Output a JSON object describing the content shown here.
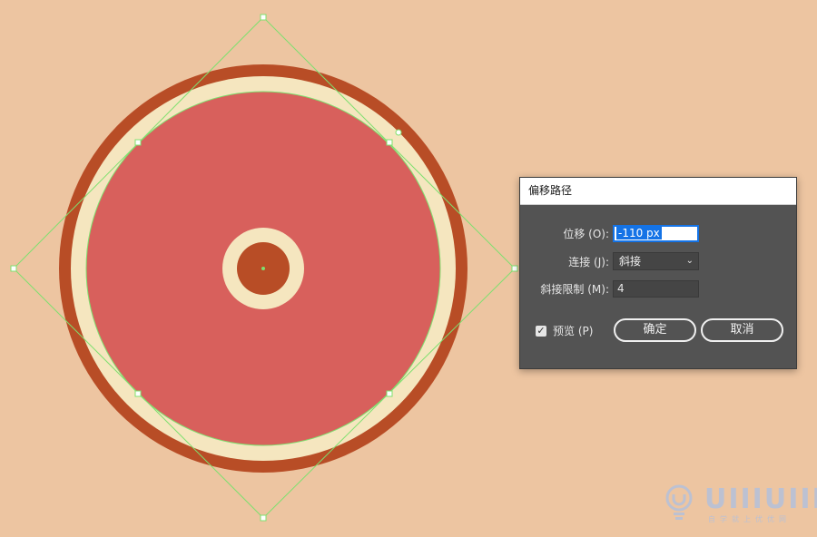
{
  "colors": {
    "background": "#EDC5A1",
    "outer_ring": "#B84D26",
    "cream_ring": "#F5E6BF",
    "main_disc": "#D8605C",
    "center_dot": "#B84D26",
    "guide": "#7EE06F",
    "dialog_bg": "#535353",
    "accent": "#1473E6"
  },
  "dialog": {
    "title": "偏移路径",
    "offset_label": "位移 (O):",
    "offset_value": "-110 px",
    "join_label": "连接 (J):",
    "join_value": "斜接",
    "miter_label": "斜接限制 (M):",
    "miter_value": "4",
    "preview_label": "预览 (P)",
    "preview_checked": true,
    "ok_label": "确定",
    "cancel_label": "取消"
  },
  "watermark": {
    "logo_text": "UIIIUIII",
    "tagline": "自学就上优优网"
  }
}
